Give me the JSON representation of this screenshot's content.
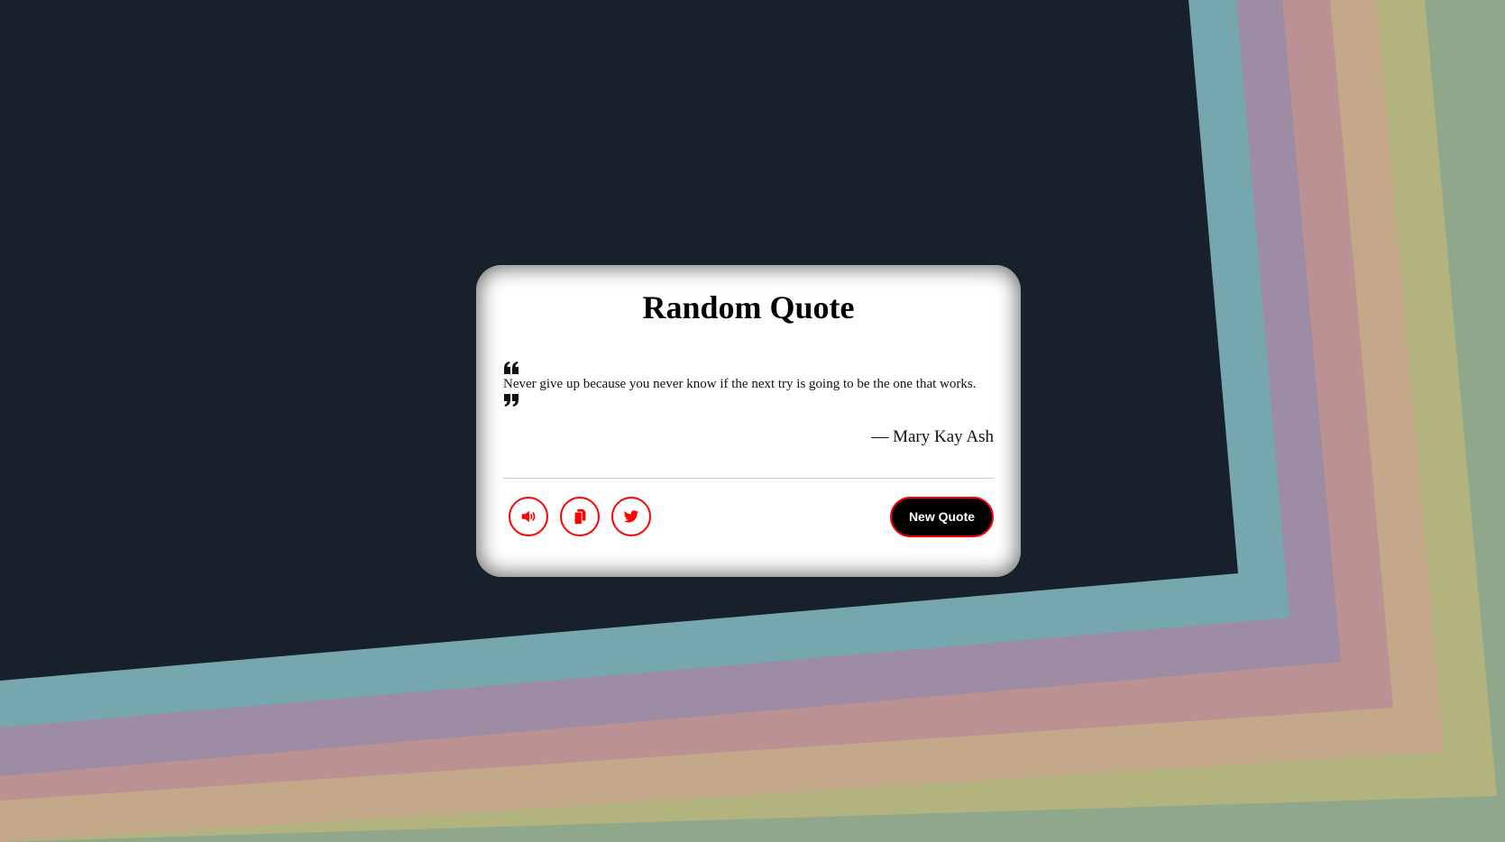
{
  "card": {
    "title": "Random Quote",
    "quote_text": "Never give up because you never know if the next try is going to be the one that works.",
    "author": "— Mary Kay Ash"
  },
  "actions": {
    "speak_icon": "volume-icon",
    "copy_icon": "copy-icon",
    "tweet_icon": "twitter-icon",
    "new_quote_label": "New Quote"
  },
  "colors": {
    "background_dark": "#17202b",
    "card_bg": "#ffffff",
    "accent_red": "#ff0000",
    "button_bg": "#000000",
    "stripes": [
      "#76a7ad",
      "#9d8ca3",
      "#bb9193",
      "#c4a88a",
      "#b3b380",
      "#8fa88c"
    ]
  }
}
